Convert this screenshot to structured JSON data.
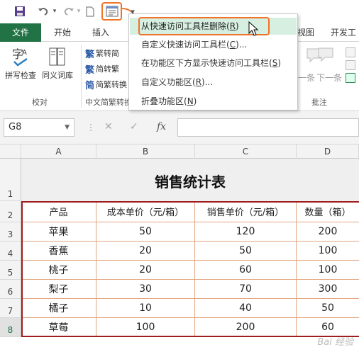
{
  "qat": {
    "icons": [
      "save-icon",
      "undo-icon",
      "redo-icon",
      "new-file-icon",
      "form-icon",
      "customize-icon"
    ]
  },
  "tabs": [
    {
      "label": "文件"
    },
    {
      "label": "开始"
    },
    {
      "label": "插入"
    },
    {
      "label": "视图"
    },
    {
      "label": "开发工"
    }
  ],
  "ribbon": {
    "proofing": {
      "spell_label": "拼写检查",
      "thesaurus_label": "同义词库",
      "group_label": "校对"
    },
    "chinese": {
      "items": [
        "繁转简",
        "简转繁",
        "简繁转换"
      ],
      "group_label": "中文简繁转换"
    },
    "comments": {
      "prev_label": "一条",
      "next_label": "下一条",
      "group_label": "批注"
    }
  },
  "namebox": {
    "value": "G8"
  },
  "formula_icons": {
    "cancel": "✕",
    "enter": "✓",
    "fx": "fx"
  },
  "menu": {
    "items": [
      {
        "label": "从快速访问工具栏删除(",
        "key": "R",
        "suffix": ")"
      },
      {
        "label": "自定义快速访问工具栏(",
        "key": "C",
        "suffix": ")..."
      },
      {
        "label": "在功能区下方显示快速访问工具栏(",
        "key": "S",
        "suffix": ")"
      },
      {
        "label": "自定义功能区(",
        "key": "R",
        "suffix": ")..."
      },
      {
        "label": "折叠功能区(",
        "key": "N",
        "suffix": ")"
      }
    ]
  },
  "sheet": {
    "columns": [
      "A",
      "B",
      "C",
      "D"
    ],
    "rows": [
      "1",
      "2",
      "3",
      "4",
      "5",
      "6",
      "7",
      "8"
    ],
    "title": "销售统计表",
    "headers": [
      "产品",
      "成本单价（元/箱）",
      "销售单价（元/箱）",
      "数量（箱）"
    ],
    "data": [
      [
        "苹果",
        "50",
        "120",
        "200"
      ],
      [
        "香蕉",
        "20",
        "50",
        "100"
      ],
      [
        "桃子",
        "20",
        "60",
        "100"
      ],
      [
        "梨子",
        "30",
        "70",
        "300"
      ],
      [
        "橘子",
        "10",
        "40",
        "50"
      ],
      [
        "草莓",
        "100",
        "200",
        "60"
      ]
    ]
  },
  "watermark": "Bai 经验"
}
